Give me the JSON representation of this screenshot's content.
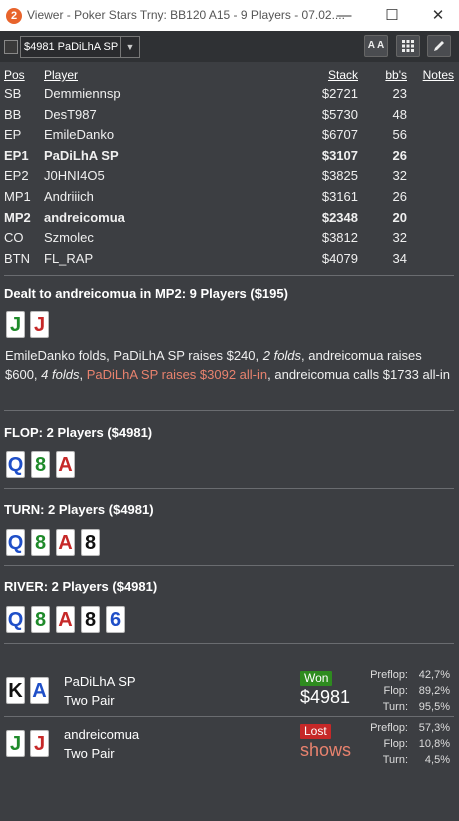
{
  "window": {
    "title": "Viewer - Poker Stars Trny: BB120 A15 - 9 Players - 07.02....",
    "app_icon": "2",
    "minimize": "—",
    "maximize": "☐",
    "close": "✕"
  },
  "toolbar": {
    "hand_select_value": "$4981 PaDiLhA SP",
    "font_size_label": "A A",
    "grid_icon": "grid-icon",
    "edit_icon": "pencil-icon"
  },
  "table": {
    "headers": {
      "pos": "Pos",
      "player": "Player",
      "stack": "Stack",
      "bbs": "bb's",
      "notes": "Notes"
    },
    "rows": [
      {
        "pos": "SB",
        "player": "Demmiennsp",
        "stack": "$2721",
        "bbs": "23",
        "bold": false
      },
      {
        "pos": "BB",
        "player": "DesT987",
        "stack": "$5730",
        "bbs": "48",
        "bold": false
      },
      {
        "pos": "EP",
        "player": "EmileDanko",
        "stack": "$6707",
        "bbs": "56",
        "bold": false
      },
      {
        "pos": "EP1",
        "player": "PaDiLhA SP",
        "stack": "$3107",
        "bbs": "26",
        "bold": true
      },
      {
        "pos": "EP2",
        "player": "J0HNI4O5",
        "stack": "$3825",
        "bbs": "32",
        "bold": false
      },
      {
        "pos": "MP1",
        "player": "Andriiich",
        "stack": "$3161",
        "bbs": "26",
        "bold": false
      },
      {
        "pos": "MP2",
        "player": "andreicomua",
        "stack": "$2348",
        "bbs": "20",
        "bold": true
      },
      {
        "pos": "CO",
        "player": "Szmolec",
        "stack": "$3812",
        "bbs": "32",
        "bold": false
      },
      {
        "pos": "BTN",
        "player": "FL_RAP",
        "stack": "$4079",
        "bbs": "34",
        "bold": false
      }
    ]
  },
  "preflop": {
    "title": "Dealt to andreicomua in MP2: 9 Players ($195)",
    "hero_cards": [
      {
        "rank": "J",
        "color": "#1f8a2a"
      },
      {
        "rank": "J",
        "color": "#c62828"
      }
    ],
    "action": {
      "p1": "EmileDanko folds, PaDiLhA SP raises $240, ",
      "p2": "2 folds",
      "p3": ", andreicomua raises $600, ",
      "p4": "4 folds",
      "p5": ", ",
      "p6": "PaDiLhA SP raises $3092 all-in",
      "p7": ", andreicomua calls $1733 all-in"
    }
  },
  "flop": {
    "title": "FLOP: 2 Players ($4981)",
    "cards": [
      {
        "rank": "Q",
        "color": "#1f4fc8"
      },
      {
        "rank": "8",
        "color": "#1f8a2a"
      },
      {
        "rank": "A",
        "color": "#c62828"
      }
    ]
  },
  "turn": {
    "title": "TURN: 2 Players ($4981)",
    "cards": [
      {
        "rank": "Q",
        "color": "#1f4fc8"
      },
      {
        "rank": "8",
        "color": "#1f8a2a"
      },
      {
        "rank": "A",
        "color": "#c62828"
      },
      {
        "rank": "8",
        "color": "#111111"
      }
    ]
  },
  "river": {
    "title": "RIVER: 2 Players ($4981)",
    "cards": [
      {
        "rank": "Q",
        "color": "#1f4fc8"
      },
      {
        "rank": "8",
        "color": "#1f8a2a"
      },
      {
        "rank": "A",
        "color": "#c62828"
      },
      {
        "rank": "8",
        "color": "#111111"
      },
      {
        "rank": "6",
        "color": "#1f4fc8"
      }
    ]
  },
  "showdown": [
    {
      "cards": [
        {
          "rank": "K",
          "color": "#111111"
        },
        {
          "rank": "A",
          "color": "#1f4fc8"
        }
      ],
      "player": "PaDiLhA SP",
      "hand": "Two Pair",
      "badge": "Won",
      "badge_color": "#2e8b1f",
      "result": "$4981",
      "result_color": "#ffffff",
      "equity": [
        {
          "label": "Preflop:",
          "value": "42,7%"
        },
        {
          "label": "Flop:",
          "value": "89,2%"
        },
        {
          "label": "Turn:",
          "value": "95,5%"
        }
      ]
    },
    {
      "cards": [
        {
          "rank": "J",
          "color": "#1f8a2a"
        },
        {
          "rank": "J",
          "color": "#c62828"
        }
      ],
      "player": "andreicomua",
      "hand": "Two Pair",
      "badge": "Lost",
      "badge_color": "#c62828",
      "result": "shows",
      "result_color": "#e8826e",
      "equity": [
        {
          "label": "Preflop:",
          "value": "57,3%"
        },
        {
          "label": "Flop:",
          "value": "10,8%"
        },
        {
          "label": "Turn:",
          "value": "4,5%"
        }
      ]
    }
  ]
}
